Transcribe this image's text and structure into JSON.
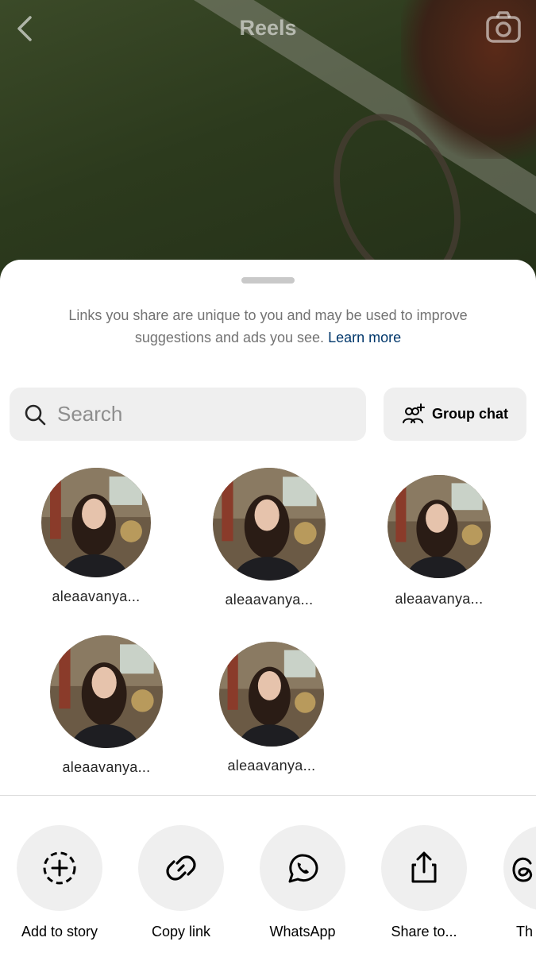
{
  "header": {
    "title": "Reels"
  },
  "sheet": {
    "notice_text": "Links you share are unique to you and may be used to improve suggestions and ads you see.",
    "learn_more": "Learn more",
    "search_placeholder": "Search",
    "group_chat_label": "Group chat"
  },
  "contacts": [
    {
      "name": "aleaavanya..."
    },
    {
      "name": "aleaavanya..."
    },
    {
      "name": "aleaavanya..."
    },
    {
      "name": "aleaavanya..."
    },
    {
      "name": "aleaavanya..."
    }
  ],
  "actions": [
    {
      "label": "Add to story",
      "icon": "add-story-icon"
    },
    {
      "label": "Copy link",
      "icon": "link-icon"
    },
    {
      "label": "WhatsApp",
      "icon": "whatsapp-icon"
    },
    {
      "label": "Share to...",
      "icon": "share-icon"
    },
    {
      "label": "Th",
      "icon": "threads-icon"
    }
  ],
  "colors": {
    "link": "#00376b",
    "muted_text": "#737373",
    "chip_bg": "#efefef"
  }
}
